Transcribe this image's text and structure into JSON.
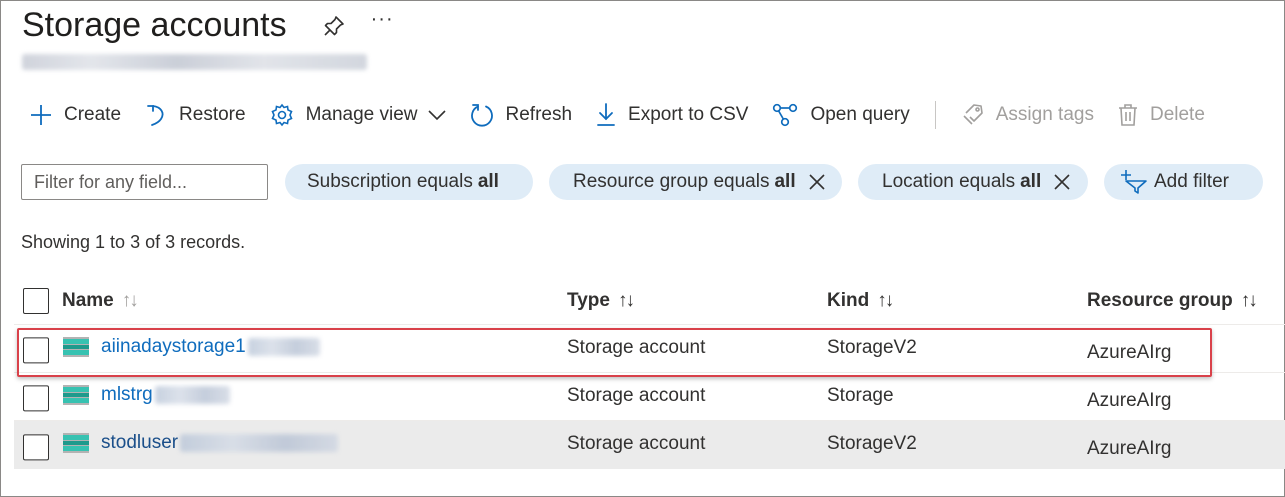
{
  "page": {
    "title": "Storage accounts"
  },
  "toolbar": {
    "create": "Create",
    "restore": "Restore",
    "manage_view": "Manage view",
    "refresh": "Refresh",
    "export_csv": "Export to CSV",
    "open_query": "Open query",
    "assign_tags": "Assign tags",
    "delete": "Delete"
  },
  "filters": {
    "search_placeholder": "Filter for any field...",
    "subscription": {
      "label": "Subscription equals",
      "value": "all"
    },
    "resource_group": {
      "label": "Resource group equals",
      "value": "all"
    },
    "location": {
      "label": "Location equals",
      "value": "all"
    },
    "add_filter": "Add filter"
  },
  "records_text": "Showing 1 to 3 of 3 records.",
  "table": {
    "columns": [
      "Name",
      "Type",
      "Kind",
      "Resource group"
    ],
    "sort_glyph": "↑↓",
    "rows": [
      {
        "name": "aiinadaystorage1",
        "type": "Storage account",
        "kind": "StorageV2",
        "resource_group": "AzureAIrg"
      },
      {
        "name": "mlstrg",
        "type": "Storage account",
        "kind": "Storage",
        "resource_group": "AzureAIrg"
      },
      {
        "name": "stodluser",
        "type": "Storage account",
        "kind": "StorageV2",
        "resource_group": "AzureAIrg"
      }
    ]
  },
  "colors": {
    "accent": "#0f6cbd",
    "pill_bg": "#dfecf7",
    "highlight": "#d9414a"
  },
  "icons": [
    "pin-icon",
    "more-icon",
    "plus-icon",
    "restore-icon",
    "gear-icon",
    "chevron-down-icon",
    "refresh-icon",
    "download-icon",
    "query-icon",
    "tag-icon",
    "trash-icon",
    "close-icon",
    "add-filter-icon",
    "storage-account-icon"
  ]
}
